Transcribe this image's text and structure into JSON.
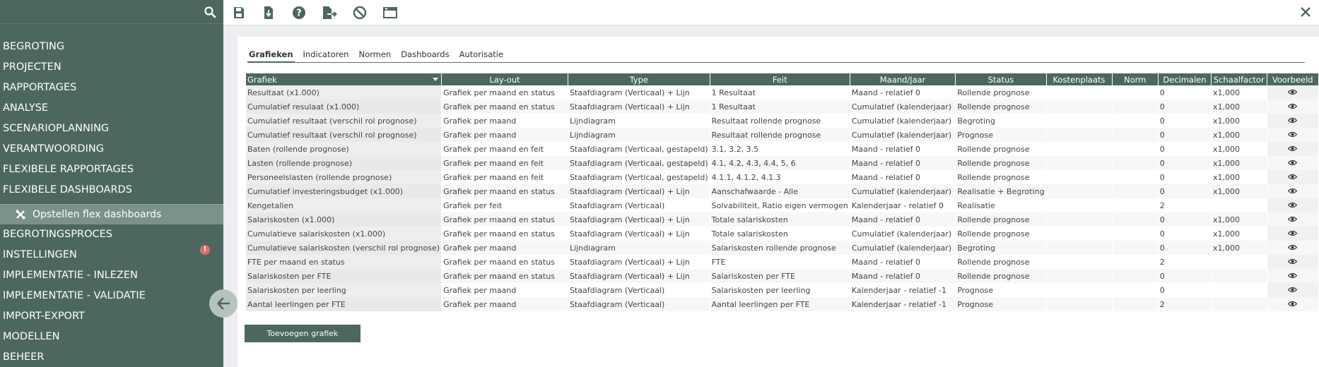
{
  "search": {
    "placeholder": ""
  },
  "sidebar": {
    "items": [
      {
        "label": "BEGROTING"
      },
      {
        "label": "PROJECTEN"
      },
      {
        "label": "RAPPORTAGES"
      },
      {
        "label": "ANALYSE"
      },
      {
        "label": "SCENARIOPLANNING"
      },
      {
        "label": "VERANTWOORDING"
      },
      {
        "label": "FLEXIBELE RAPPORTAGES"
      },
      {
        "label": "FLEXIBELE DASHBOARDS"
      }
    ],
    "sub_item": {
      "label": "Opstellen flex dashboards"
    },
    "items_after": [
      {
        "label": "BEGROTINGSPROCES"
      },
      {
        "label": "INSTELLINGEN",
        "alert": "!"
      },
      {
        "label": "IMPLEMENTATIE - INLEZEN"
      },
      {
        "label": "IMPLEMENTATIE - VALIDATIE"
      },
      {
        "label": "IMPORT-EXPORT"
      },
      {
        "label": "MODELLEN"
      },
      {
        "label": "BEHEER"
      }
    ]
  },
  "tabs": [
    "Grafieken",
    "Indicatoren",
    "Normen",
    "Dashboards",
    "Autorisatie"
  ],
  "table": {
    "headers": [
      "Grafiek",
      "Lay-out",
      "Type",
      "Feit",
      "Maand/Jaar",
      "Status",
      "Kostenplaats",
      "Norm",
      "Decimalen",
      "Schaalfactor",
      "Voorbeeld"
    ],
    "rows": [
      [
        "Resultaat (x1.000)",
        "Grafiek per maand en status",
        "Staafdiagram (Verticaal) + Lijn",
        "1 Resultaat",
        "Maand - relatief 0",
        "Rollende prognose",
        "",
        "",
        "0",
        "x1,000"
      ],
      [
        "Cumulatief resulaat (x1.000)",
        "Grafiek per maand en status",
        "Staafdiagram (Verticaal) + Lijn",
        "1 Resultaat",
        "Cumulatief (kalenderjaar)",
        "Rollende prognose",
        "",
        "",
        "0",
        "x1,000"
      ],
      [
        "Cumulatief resultaat (verschil rol prognose)",
        "Grafiek per maand",
        "Lijndiagram",
        "Resultaat rollende prognose",
        "Cumulatief (kalenderjaar)",
        "Begroting",
        "",
        "",
        "0",
        "x1,000"
      ],
      [
        "Cumulatief resultaat (verschil rol prognose)",
        "Grafiek per maand",
        "Lijndiagram",
        "Resultaat rollende prognose",
        "Cumulatief (kalenderjaar)",
        "Prognose",
        "",
        "",
        "0",
        "x1,000"
      ],
      [
        "Baten (rollende prognose)",
        "Grafiek per maand en feit",
        "Staafdiagram (Verticaal, gestapeld)",
        "3.1, 3.2, 3.5",
        "Maand - relatief 0",
        "Rollende prognose",
        "",
        "",
        "0",
        "x1,000"
      ],
      [
        "Lasten (rollende prognose)",
        "Grafiek per maand en feit",
        "Staafdiagram (Verticaal, gestapeld)",
        "4.1, 4.2, 4.3, 4.4, 5, 6",
        "Maand - relatief 0",
        "Rollende prognose",
        "",
        "",
        "0",
        "x1,000"
      ],
      [
        "Personeelslasten (rollende prognose)",
        "Grafiek per maand en feit",
        "Staafdiagram (Verticaal, gestapeld)",
        "4.1.1, 4.1.2, 4.1.3",
        "Maand - relatief 0",
        "Rollende prognose",
        "",
        "",
        "0",
        "x1,000"
      ],
      [
        "Cumulatief investeringsbudget (x1.000)",
        "Grafiek per maand en status",
        "Staafdiagram (Verticaal) + Lijn",
        "Aanschafwaarde - Alle",
        "Cumulatief (kalenderjaar)",
        "Realisatie + Begroting",
        "",
        "",
        "0",
        "x1,000"
      ],
      [
        "Kengetallen",
        "Grafiek per feit",
        "Staafdiagram (Verticaal)",
        "Solvabiliteit, Ratio eigen vermogen",
        "Kalenderjaar - relatief 0",
        "Realisatie",
        "",
        "",
        "2",
        ""
      ],
      [
        "Salariskosten (x1.000)",
        "Grafiek per maand en status",
        "Staafdiagram (Verticaal) + Lijn",
        "Totale salariskosten",
        "Maand - relatief 0",
        "Rollende prognose",
        "",
        "",
        "0",
        "x1,000"
      ],
      [
        "Cumulatieve salariskosten (x1.000)",
        "Grafiek per maand en status",
        "Staafdiagram (Verticaal) + Lijn",
        "Totale salariskosten",
        "Cumulatief (kalenderjaar)",
        "Rollende prognose",
        "",
        "",
        "0",
        "x1,000"
      ],
      [
        "Cumulatieve salariskosten (verschil rol prognose)",
        "Grafiek per maand",
        "Lijndiagram",
        "Salariskosten rollende prognose",
        "Cumulatief (kalenderjaar)",
        "Begroting",
        "",
        "",
        "0",
        "x1,000"
      ],
      [
        "FTE per maand en status",
        "Grafiek per maand en status",
        "Staafdiagram (Verticaal) + Lijn",
        "FTE",
        "Maand - relatief 0",
        "Rollende prognose",
        "",
        "",
        "2",
        ""
      ],
      [
        "Salariskosten per FTE",
        "Grafiek per maand en status",
        "Staafdiagram (Verticaal) + Lijn",
        "Salariskosten per FTE",
        "Maand - relatief 0",
        "Rollende prognose",
        "",
        "",
        "0",
        ""
      ],
      [
        "Salariskosten per leerling",
        "Grafiek per maand",
        "Staafdiagram (Verticaal)",
        "Salariskosten per leerling",
        "Kalenderjaar - relatief -1",
        "Prognose",
        "",
        "",
        "0",
        ""
      ],
      [
        "Aantal leerlingen per FTE",
        "Grafiek per maand",
        "Staafdiagram (Verticaal)",
        "Aantal leerlingen per FTE",
        "Kalenderjaar - relatief -1",
        "Prognose",
        "",
        "",
        "2",
        ""
      ]
    ]
  },
  "add_button": {
    "label": "Toevoegen grafiek"
  },
  "colors": {
    "sidebar": "#4c6760",
    "sidebar_sub": "#7a928b",
    "alert": "#e06b6b",
    "header": "#4c6760"
  }
}
